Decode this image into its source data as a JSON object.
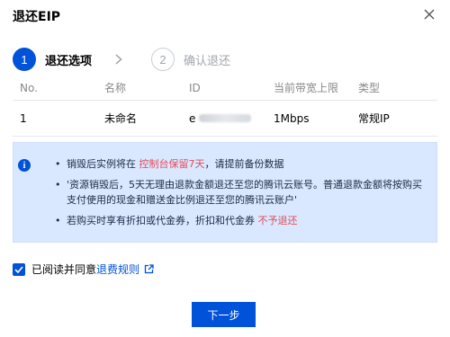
{
  "dialog": {
    "title": "退还EIP"
  },
  "steps": [
    {
      "number": "1",
      "label": "退还选项"
    },
    {
      "number": "2",
      "label": "确认退还"
    }
  ],
  "table": {
    "headers": [
      "No.",
      "名称",
      "ID",
      "当前带宽上限",
      "类型"
    ],
    "rows": [
      {
        "no": "1",
        "name": "未命名",
        "id_prefix": "e",
        "bandwidth": "1Mbps",
        "type": "常规IP"
      }
    ]
  },
  "notice": {
    "item1_prefix": "销毁后实例将在 ",
    "item1_highlight": "控制台保留7天",
    "item1_suffix": "，请提前备份数据",
    "item2": "'资源销毁后，5天无理由退款金额退还至您的腾讯云账号。普通退款金额将按购买支付使用的现金和赠送金比例退还至您的腾讯云账户'",
    "item3_prefix": "若购买时享有折扣或代金券，折扣和代金券 ",
    "item3_highlight": "不予退还"
  },
  "agreement": {
    "prefix": "已阅读并同意",
    "link": "退费规则",
    "checked": true
  },
  "footer": {
    "next_label": "下一步"
  },
  "colors": {
    "primary": "#0052d9",
    "warning_red": "#e34d59",
    "notice_bg": "#d9e7ff"
  }
}
